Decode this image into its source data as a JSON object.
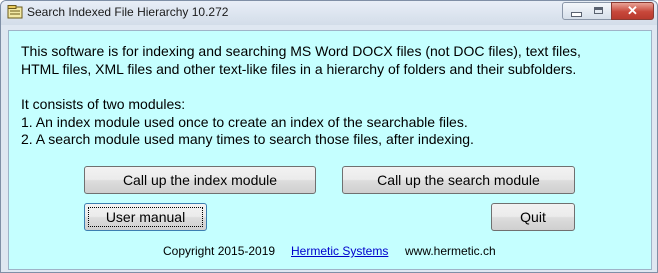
{
  "window": {
    "title": "Search Indexed File Hierarchy 10.272",
    "controls": {
      "minimize": "minimize-icon",
      "maximize": "maximize-icon",
      "close": "close-icon",
      "close_glyph": "✕"
    }
  },
  "description": {
    "line1": "This software is for indexing and searching MS Word DOCX files (not DOC files), text files,",
    "line2": "HTML files, XML files and other text-like files in a hierarchy of folders and their subfolders.",
    "line3": "It consists of two modules:",
    "line4": "1. An index module used once to create an index of the searchable files.",
    "line5": "2. A search module used many times to search those files, after indexing."
  },
  "buttons": {
    "index": "Call up the index module",
    "search": "Call up the search module",
    "manual": "User manual",
    "quit": "Quit"
  },
  "footer": {
    "copyright": "Copyright 2015-2019",
    "link": "Hermetic Systems",
    "website": "www.hermetic.ch"
  },
  "colors": {
    "client_background": "#c5ffff",
    "link": "#0000cc"
  }
}
